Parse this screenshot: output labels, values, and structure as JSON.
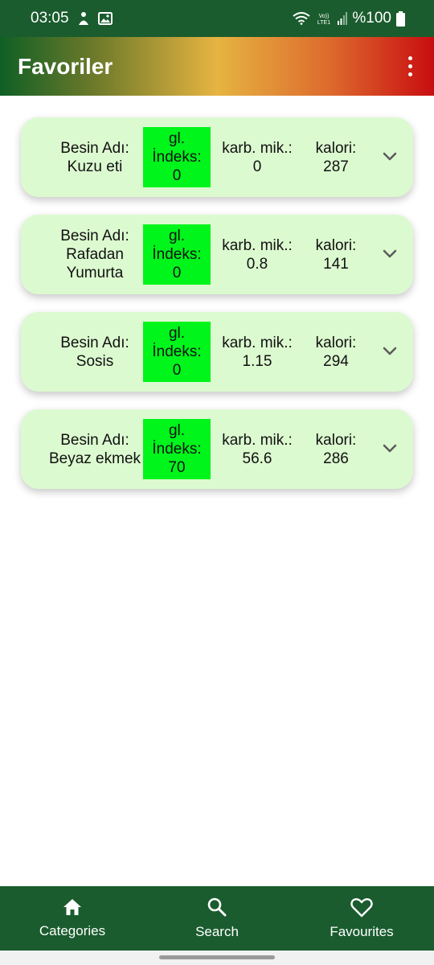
{
  "status_bar": {
    "time": "03:05",
    "battery_text": "%100",
    "icons": [
      "notification-icon",
      "gallery-icon",
      "wifi-icon",
      "volte-lte-icon",
      "signal-icon",
      "battery-icon"
    ]
  },
  "app_bar": {
    "title": "Favoriler",
    "menu_icon": "more-vert-icon"
  },
  "foods": [
    {
      "name_label": "Besin Adı:",
      "name": "Kuzu eti",
      "gi_label_1": "gl.",
      "gi_label_2": "İndeks:",
      "gi_value": "0",
      "carb_label": "karb. mik.:",
      "carb_value": "0",
      "cal_label": "kalori:",
      "cal_value": "287"
    },
    {
      "name_label": "Besin Adı:",
      "name": "Rafadan Yumurta",
      "gi_label_1": "gl.",
      "gi_label_2": "İndeks:",
      "gi_value": "0",
      "carb_label": "karb. mik.:",
      "carb_value": "0.8",
      "cal_label": "kalori:",
      "cal_value": "141"
    },
    {
      "name_label": "Besin Adı:",
      "name": "Sosis",
      "gi_label_1": "gl.",
      "gi_label_2": "İndeks:",
      "gi_value": "0",
      "carb_label": "karb. mik.:",
      "carb_value": "1.15",
      "cal_label": "kalori:",
      "cal_value": "294"
    },
    {
      "name_label": "Besin Adı:",
      "name": "Beyaz ekmek",
      "gi_label_1": "gl.",
      "gi_label_2": "İndeks:",
      "gi_value": "70",
      "carb_label": "karb. mik.:",
      "carb_value": "56.6",
      "cal_label": "kalori:",
      "cal_value": "286"
    }
  ],
  "bottom_nav": {
    "items": [
      {
        "label": "Categories",
        "icon": "home-icon"
      },
      {
        "label": "Search",
        "icon": "search-icon"
      },
      {
        "label": "Favourites",
        "icon": "heart-icon"
      }
    ]
  },
  "colors": {
    "status_bar": "#1a5c2e",
    "card_bg": "#dcfad0",
    "gi_box": "#00f51b",
    "bottom_nav": "#1a5c2e"
  }
}
